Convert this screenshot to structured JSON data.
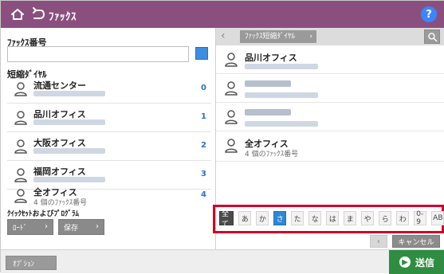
{
  "header": {
    "title": "ﾌｧｯｸｽ",
    "help_label": "?"
  },
  "left": {
    "fax_number_label": "ﾌｧｯｸｽ番号",
    "fax_number_value": "",
    "speed_dial_label": "短縮ﾀﾞｲﾔﾙ",
    "contacts": [
      {
        "name": "流通センター",
        "index": "0",
        "sub": ""
      },
      {
        "name": "品川オフィス",
        "index": "1",
        "sub": ""
      },
      {
        "name": "大阪オフィス",
        "index": "2",
        "sub": ""
      },
      {
        "name": "福岡オフィス",
        "index": "3",
        "sub": ""
      },
      {
        "name": "全オフィス",
        "index": "4",
        "sub": "4 個のﾌｧｯｸｽ番号"
      }
    ],
    "quick_setup_label": "ｸｲｯｸｾｯﾄおよびﾌﾟﾛｸﾞﾗﾑ",
    "load_button": "ﾛｰﾄﾞ",
    "save_button": "保存"
  },
  "right": {
    "breadcrumb": "ﾌｧｯｸｽ短縮ﾀﾞｲﾔﾙ",
    "contacts": [
      {
        "name": "品川オフィス",
        "sub": ""
      },
      {
        "name": "",
        "sub": ""
      },
      {
        "name": "",
        "sub": ""
      },
      {
        "name": "全オフィス",
        "sub": "4 個のﾌｧｯｸｽ番号"
      }
    ],
    "kana_filters": [
      "全て",
      "あ",
      "か",
      "さ",
      "た",
      "な",
      "は",
      "ま",
      "や",
      "ら",
      "わ",
      "0-9",
      "AB"
    ],
    "selected_filter": "さ",
    "cancel_button": "キャンセル"
  },
  "bottom": {
    "options_button": "ｵﾌﾟｼｮﾝ",
    "send_button": "送信"
  },
  "colors": {
    "header": "#8a4f7f",
    "accent": "#2f86d6",
    "send": "#2f8d42",
    "highlight_box": "#d0002b"
  }
}
